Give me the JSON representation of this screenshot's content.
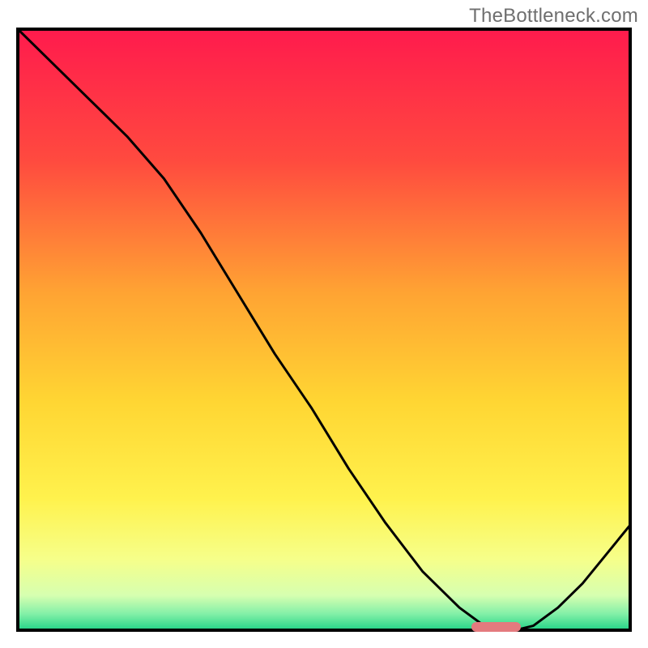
{
  "watermark": "TheBottleneck.com",
  "chart_data": {
    "type": "line",
    "title": "",
    "xlabel": "",
    "ylabel": "",
    "xlim": [
      0,
      100
    ],
    "ylim": [
      0,
      100
    ],
    "x": [
      0,
      6,
      12,
      18,
      24,
      30,
      36,
      42,
      48,
      54,
      60,
      66,
      72,
      76,
      80,
      84,
      88,
      92,
      96,
      100
    ],
    "values": [
      100,
      94,
      88,
      82,
      75,
      66,
      56,
      46,
      37,
      27,
      18,
      10,
      4,
      1,
      0,
      1,
      4,
      8,
      13,
      18
    ],
    "min_marker": {
      "x_start": 74,
      "x_end": 82,
      "y": 0,
      "height_pct": 1.6
    },
    "gradient_stops": [
      {
        "offset": 0.0,
        "color": "#ff1a4d"
      },
      {
        "offset": 0.22,
        "color": "#ff4a3f"
      },
      {
        "offset": 0.44,
        "color": "#ffa433"
      },
      {
        "offset": 0.62,
        "color": "#ffd633"
      },
      {
        "offset": 0.78,
        "color": "#fff24d"
      },
      {
        "offset": 0.88,
        "color": "#f6ff8a"
      },
      {
        "offset": 0.94,
        "color": "#d6ffb0"
      },
      {
        "offset": 0.97,
        "color": "#84f0a8"
      },
      {
        "offset": 1.0,
        "color": "#19d184"
      }
    ]
  },
  "colors": {
    "curve": "#000000",
    "frame": "#000000",
    "marker": "#e47a7e",
    "watermark": "#6f6f6f"
  }
}
